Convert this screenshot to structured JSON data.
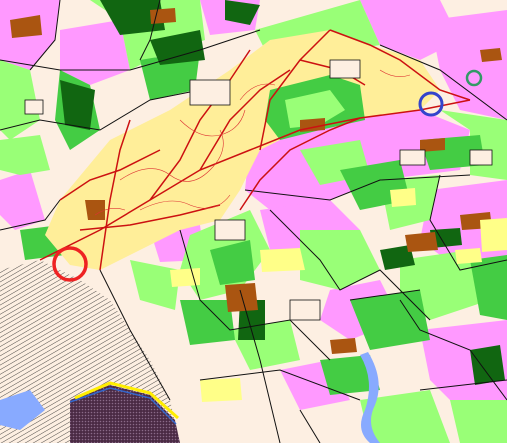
{
  "map": {
    "kind": "land-use map",
    "legend_colors": {
      "urban_light": "#fdefe2",
      "forest": "#ffee99",
      "meadow_light": "#99ff77",
      "meadow": "#44cc44",
      "woodland_dark": "#116611",
      "vineyard": "#ff99ff",
      "orchard": "#aa5511",
      "allotment": "#ffff88",
      "water": "#88aaff",
      "dense_urban": "#4a2a44",
      "roads": "#cc1111",
      "boundaries": "#111111"
    },
    "markers": [
      {
        "name": "red-circle-marker",
        "color": "#ee2222"
      },
      {
        "name": "blue-circle-marker",
        "color": "#3344cc"
      },
      {
        "name": "green-circle-marker",
        "color": "#339966"
      }
    ]
  }
}
